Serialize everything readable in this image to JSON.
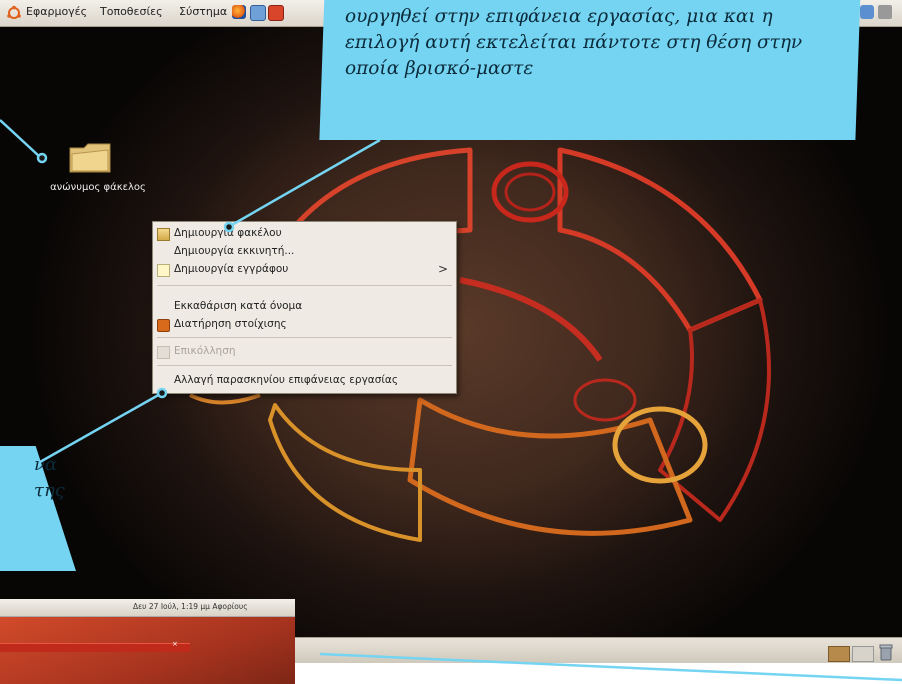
{
  "top_panel": {
    "menus": [
      "Εφαρμογές",
      "Τοποθεσίες",
      "Σύστημα"
    ]
  },
  "desktop": {
    "folder_label": "ανώνυμος φάκελος"
  },
  "context_menu": {
    "items": [
      {
        "label": "Δημιουργία φακέλου",
        "icon": "folder-new-icon"
      },
      {
        "label": "Δημιουργία εκκινητή..."
      },
      {
        "label": "Δημιουργία εγγράφου",
        "icon": "document-icon",
        "submenu": true
      },
      {
        "label": "Εκκαθάριση κατά όνομα"
      },
      {
        "label": "Διατήρηση στοίχισης",
        "icon": "check-icon"
      },
      {
        "label": "Επικόλληση",
        "disabled": true,
        "icon": "paste-icon"
      },
      {
        "label": "Αλλαγή παρασκηνίου επιφάνειας εργασίας"
      }
    ],
    "submenu_arrow": ">"
  },
  "inset": {
    "clock": "Δευ 27 Ιούλ, 1:19 μμ Αφορίους",
    "close": "×"
  },
  "callouts": {
    "top": "ουργηθεί στην επιφάνεια εργασίας, μια και η επιλογή αυτή εκτελείται πάντοτε στη θέση στην οποία βρισκό-μαστε",
    "left_line1": "να",
    "left_line2": "της"
  },
  "colors": {
    "callout": "#74d4f2",
    "menu_bg": "#efebe4",
    "ubuntu_red": "#c9291d",
    "ubuntu_orange": "#e28a1f"
  }
}
